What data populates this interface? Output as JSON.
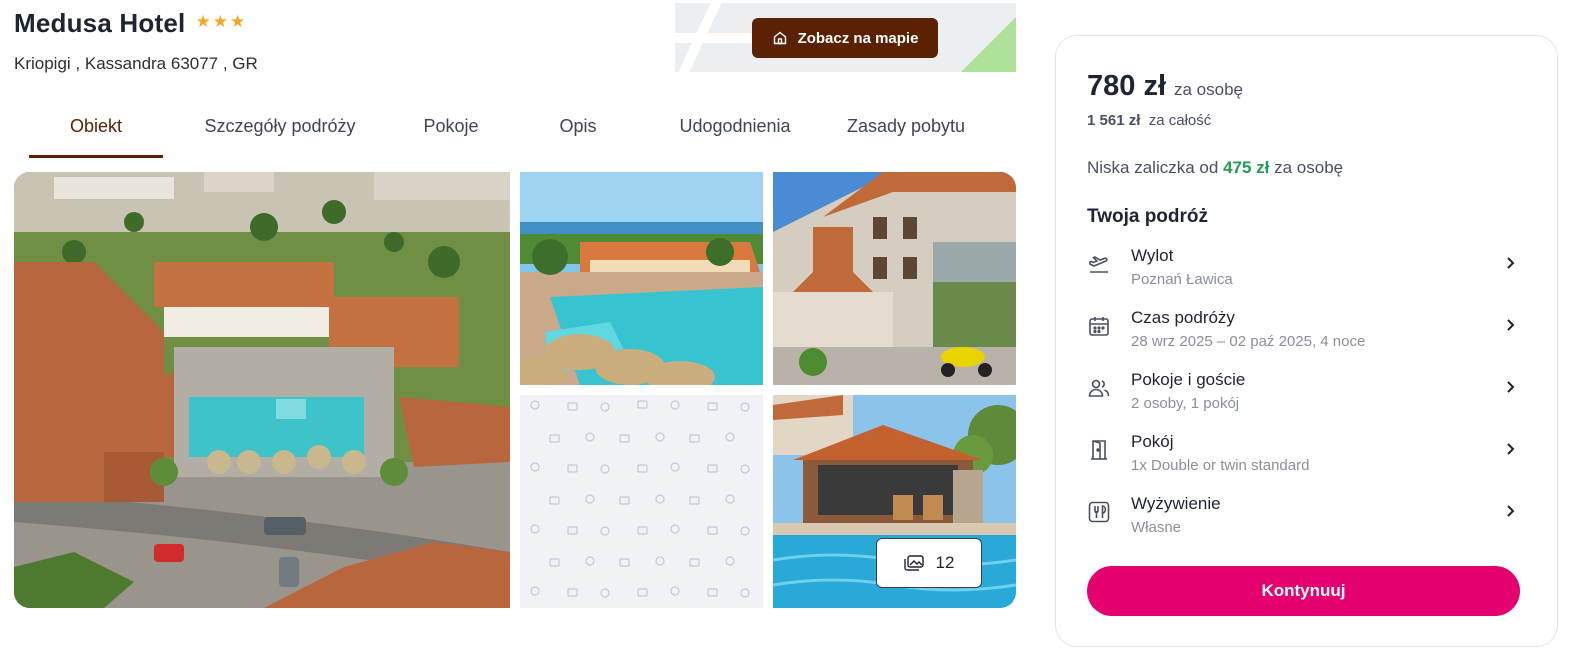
{
  "hotel": {
    "name": "Medusa Hotel",
    "stars": 3,
    "address": "Kriopigi , Kassandra 63077 , GR"
  },
  "map_button": {
    "label": "Zobacz na mapie",
    "icon": "house-icon"
  },
  "tabs": [
    {
      "label": "Obiekt",
      "active": true
    },
    {
      "label": "Szczegóły podróży",
      "active": false
    },
    {
      "label": "Pokoje",
      "active": false
    },
    {
      "label": "Opis",
      "active": false
    },
    {
      "label": "Udogodnienia",
      "active": false
    },
    {
      "label": "Zasady pobytu",
      "active": false
    }
  ],
  "gallery": {
    "photo_count": "12",
    "images": [
      "aerial-hotel-photo",
      "pool-photo",
      "hotel-front-photo",
      "placeholder-pattern",
      "pool-bar-photo"
    ]
  },
  "booking": {
    "price": "780 zł",
    "price_unit": "za osobę",
    "total_value": "1 561 zł",
    "total_unit": "za całość",
    "deposit_prefix": "Niska zaliczka od",
    "deposit_value": "475 zł",
    "deposit_suffix": "za osobę",
    "trip_title": "Twoja podróż",
    "rows": [
      {
        "label": "Wylot",
        "value": "Poznań Ławica",
        "icon": "plane-departure-icon"
      },
      {
        "label": "Czas podróży",
        "value": "28 wrz 2025 – 02 paź 2025, 4 noce",
        "icon": "calendar-icon"
      },
      {
        "label": "Pokoje i goście",
        "value": "2 osoby, 1 pokój",
        "icon": "people-icon"
      },
      {
        "label": "Pokój",
        "value": "1x Double or twin standard",
        "icon": "door-icon"
      },
      {
        "label": "Wyżywienie",
        "value": "Własne",
        "icon": "cutlery-icon"
      }
    ],
    "continue_label": "Kontynuuj"
  },
  "colors": {
    "brand_brown": "#5a2103",
    "accent_pink": "#e5006f",
    "deposit_green": "#1f9d55",
    "star_orange": "#f5a623"
  }
}
